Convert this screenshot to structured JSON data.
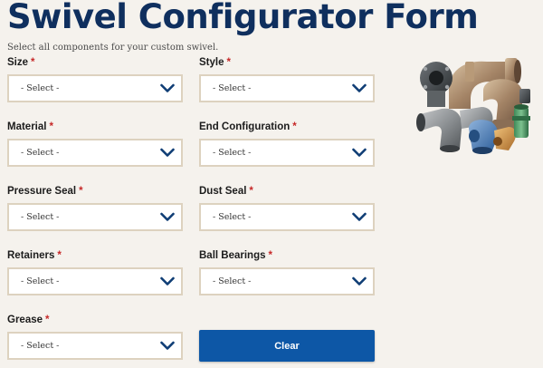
{
  "header": {
    "title": "Swivel Configurator Form",
    "subtitle": "Select all components for your custom swivel."
  },
  "fields": [
    {
      "label": "Size",
      "required_mark": "*",
      "value": "- Select -"
    },
    {
      "label": "Style",
      "required_mark": "*",
      "value": "- Select -"
    },
    {
      "label": "Material",
      "required_mark": "*",
      "value": "- Select -"
    },
    {
      "label": "End Configuration",
      "required_mark": "*",
      "value": "- Select -"
    },
    {
      "label": "Pressure Seal",
      "required_mark": "*",
      "value": "- Select -"
    },
    {
      "label": "Dust Seal",
      "required_mark": "*",
      "value": "- Select -"
    },
    {
      "label": "Retainers",
      "required_mark": "*",
      "value": "- Select -"
    },
    {
      "label": "Ball Bearings",
      "required_mark": "*",
      "value": "- Select -"
    },
    {
      "label": "Grease",
      "required_mark": "*",
      "value": "- Select -"
    }
  ],
  "actions": {
    "clear_label": "Clear"
  },
  "colors": {
    "title": "#0f2f5e",
    "required": "#c62828",
    "chevron": "#0f3d75",
    "button": "#0d57a6",
    "select_border": "#ddd2bf",
    "background": "#f5f2ed"
  },
  "product_image": {
    "icon": "swivel-fittings-image"
  }
}
